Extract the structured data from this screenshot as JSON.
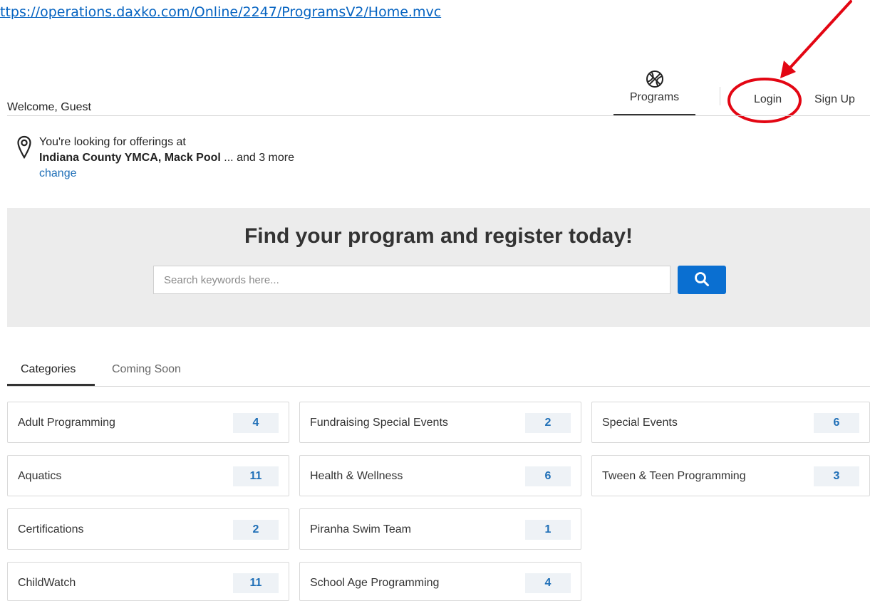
{
  "url_text": "ttps://operations.daxko.com/Online/2247/ProgramsV2/Home.mvc",
  "header": {
    "welcome": "Welcome, Guest",
    "nav": {
      "programs": "Programs",
      "login": "Login",
      "signup": "Sign Up"
    }
  },
  "location": {
    "line1": "You're looking for offerings at",
    "branches": "Indiana County YMCA, Mack Pool",
    "more": " ... and 3 more",
    "change": "change"
  },
  "hero": {
    "title": "Find your program and register today!",
    "search_placeholder": "Search keywords here..."
  },
  "tabs": [
    "Categories",
    "Coming Soon"
  ],
  "categories": [
    {
      "label": "Adult Programming",
      "count": "4"
    },
    {
      "label": "Fundraising Special Events",
      "count": "2"
    },
    {
      "label": "Special Events",
      "count": "6"
    },
    {
      "label": "Aquatics",
      "count": "11"
    },
    {
      "label": "Health & Wellness",
      "count": "6"
    },
    {
      "label": "Tween & Teen Programming",
      "count": "3"
    },
    {
      "label": "Certifications",
      "count": "2"
    },
    {
      "label": "Piranha Swim Team",
      "count": "1"
    },
    {
      "label": "ChildWatch",
      "count": "11"
    },
    {
      "label": "School Age Programming",
      "count": "4"
    }
  ],
  "colors": {
    "accent_blue": "#0a6fd1",
    "link_blue": "#1f6fb7",
    "annotation_red": "#e30613",
    "hero_bg": "#ececec"
  },
  "icons": {
    "programs": "basketball-icon",
    "location": "map-pin-icon",
    "search": "magnifier-icon"
  }
}
